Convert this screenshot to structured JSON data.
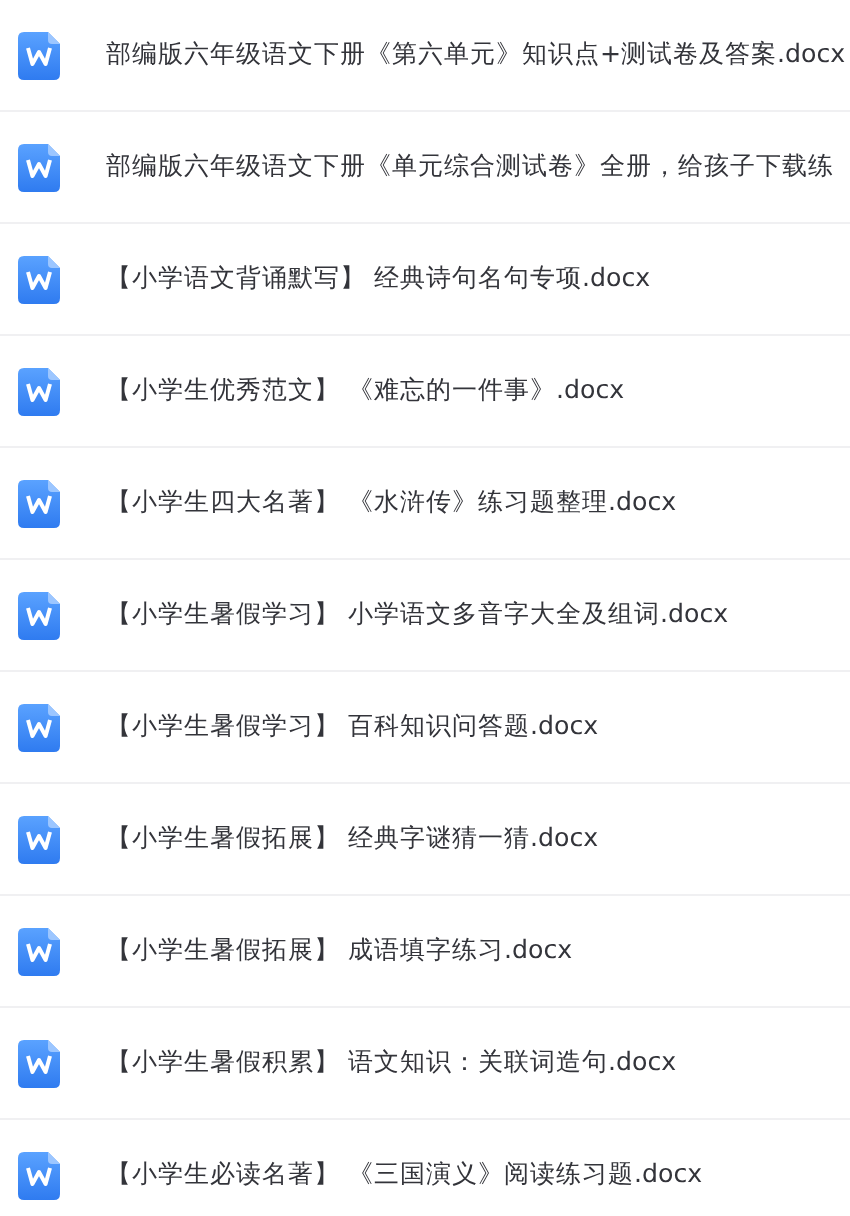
{
  "files": [
    {
      "name": "部编版六年级语文下册《第六单元》知识点+测试卷及答案.docx"
    },
    {
      "name": "部编版六年级语文下册《单元综合测试卷》全册，给孩子下载练"
    },
    {
      "name": "【小学语文背诵默写】 经典诗句名句专项.docx"
    },
    {
      "name": "【小学生优秀范文】 《难忘的一件事》.docx"
    },
    {
      "name": "【小学生四大名著】 《水浒传》练习题整理.docx"
    },
    {
      "name": "【小学生暑假学习】 小学语文多音字大全及组词.docx"
    },
    {
      "name": "【小学生暑假学习】 百科知识问答题.docx"
    },
    {
      "name": "【小学生暑假拓展】 经典字谜猜一猜.docx"
    },
    {
      "name": "【小学生暑假拓展】 成语填字练习.docx"
    },
    {
      "name": "【小学生暑假积累】 语文知识：关联词造句.docx"
    },
    {
      "name": "【小学生必读名著】 《三国演义》阅读练习题.docx"
    }
  ]
}
